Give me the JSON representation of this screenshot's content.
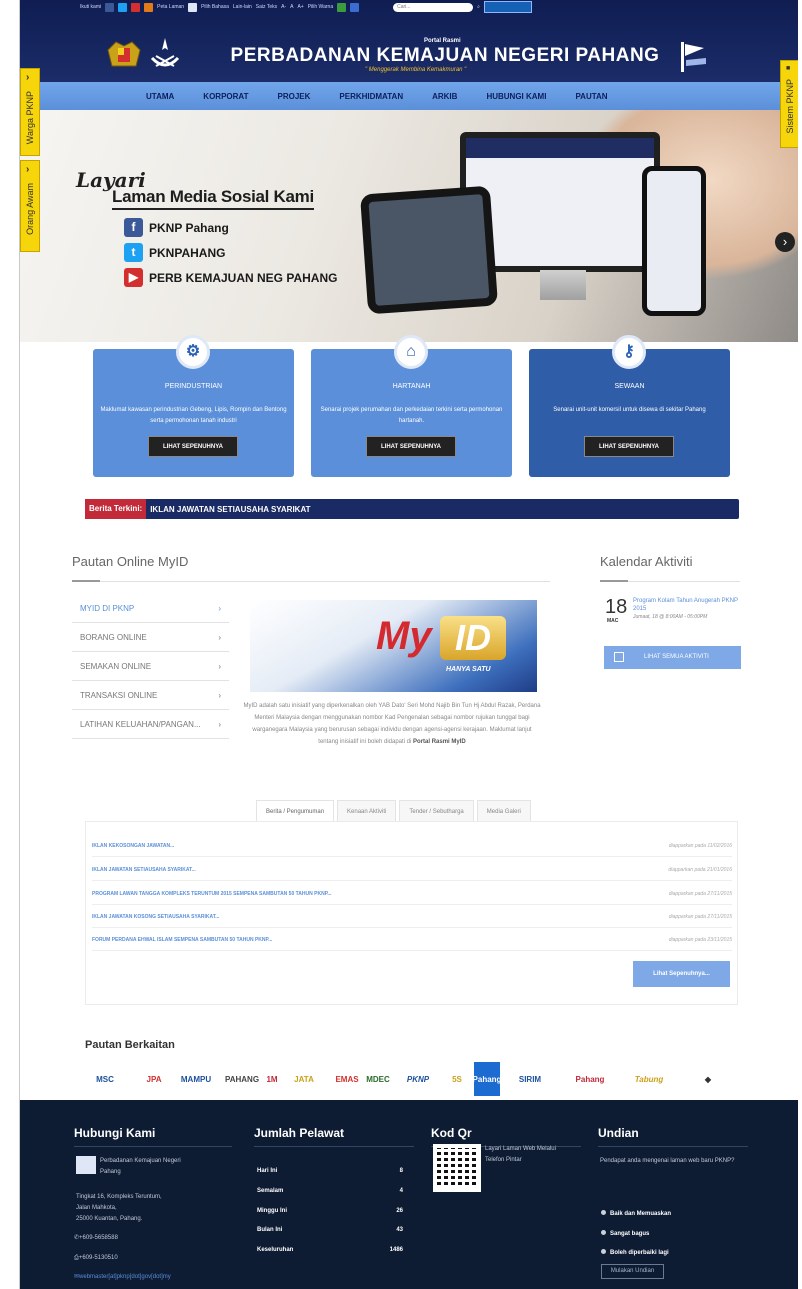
{
  "topbar": {
    "items": [
      "Ikuti kami",
      "Peta Laman",
      "Pilih Bahasa",
      "Lain-lain",
      "Saiz Teks",
      "A-",
      "A",
      "A+",
      "Pilih Warna"
    ],
    "search_placeholder": "Cari..."
  },
  "header": {
    "portal_label": "Portal Rasmi",
    "title": "PERBADANAN KEMAJUAN NEGERI PAHANG",
    "tagline": "\" Menggerak Membina Kemakmuran \""
  },
  "nav": {
    "items": [
      "UTAMA",
      "KORPORAT",
      "PROJEK",
      "PERKHIDMATAN",
      "ARKIB",
      "HUBUNGI KAMI",
      "PAUTAN"
    ]
  },
  "side_tabs": {
    "left": [
      "Warga PKNP",
      "Orang Awam"
    ],
    "right": "Sistem PKNP"
  },
  "hero": {
    "layari": "Layari",
    "heading": "Laman Media Sosial Kami",
    "socials": [
      {
        "icon": "facebook-icon",
        "glyph": "f",
        "label": "PKNP Pahang",
        "color": "#3b5998"
      },
      {
        "icon": "twitter-icon",
        "glyph": "t",
        "label": "PKNPAHANG",
        "color": "#1da1f2"
      },
      {
        "icon": "youtube-icon",
        "glyph": "▶",
        "label": "PERB KEMAJUAN NEG PAHANG",
        "color": "#d32f2f"
      }
    ]
  },
  "services": [
    {
      "icon": "factory-icon",
      "title": "PERINDUSTRIAN",
      "desc": "Maklumat kawasan perindustrian Gebeng, Lipis, Rompin dan Bentong serta permohonan tanah industri",
      "button": "LIHAT SEPENUHNYA"
    },
    {
      "icon": "house-icon",
      "title": "HARTANAH",
      "desc": "Senarai projek perumahan dan perkedaian terkini serta permohonan hartanah.",
      "button": "LIHAT SEPENUHNYA"
    },
    {
      "icon": "key-icon",
      "title": "SEWAAN",
      "desc": "Senarai unit-unit komersil untuk disewa di sekitar Pahang",
      "button": "LIHAT SEPENUHNYA"
    }
  ],
  "ticker": {
    "label": "Berita Terkini:",
    "text": "IKLAN JAWATAN SETIAUSAHA SYARIKAT"
  },
  "myid": {
    "heading": "Pautan Online MyID",
    "menu": [
      "MYID DI PKNP",
      "BORANG ONLINE",
      "SEMAKAN ONLINE",
      "TRANSAKSI ONLINE",
      "LATIHAN KELUAHAN/PANGAN..."
    ],
    "banner_my": "My",
    "banner_id": "ID",
    "banner_tag": "HANYA SATU",
    "desc": "MyID adalah satu inisiatif yang diperkenalkan oleh YAB Dato' Seri Mohd Najib Bin Tun Hj Abdul Razak, Perdana Menteri Malaysia dengan menggunakan nombor Kad Pengenalan sebagai nombor rujukan tunggal bagi warganegara Malaysia yang berurusan sebagai individu dengan agensi-agensi kerajaan. Maklumat lanjut tentang inisiatif ini boleh didapati di",
    "desc_link": "Portal Rasmi MyID"
  },
  "kalendar": {
    "heading": "Kalendar Aktiviti",
    "day": "18",
    "month": "MAC",
    "event_title": "Program Kolam Tahun Anugerah PKNP 2015",
    "event_time": "Jumaat, 18 @ 8:00AM - 05:00PM",
    "button": "LIHAT SEMUA AKTIVITI"
  },
  "news": {
    "tabs": [
      "Berita / Pengumuman",
      "Kenaan Aktiviti",
      "Tender / Sebutharga",
      "Media Galeri"
    ],
    "rows": [
      {
        "title": "IKLAN KEKOSONGAN JAWATAN...",
        "date": "diapparkan pada 11/02/2016"
      },
      {
        "title": "IKLAN JAWATAN SETIAUSAHA SYARIKAT...",
        "date": "diapparkan pada 21/01/2016"
      },
      {
        "title": "PROGRAM LAWAN TANGGA KOMPLEKS TERUNTUM 2015 SEMPENA SAMBUTAN 50 TAHUN PKNP...",
        "date": "diapparkan pada 27/11/2015"
      },
      {
        "title": "IKLAN JAWATAN KOSONG SETIAUSAHA SYARIKAT...",
        "date": "diapparkan pada 27/11/2015"
      },
      {
        "title": "FORUM PERDANA EHWAL ISLAM SEMPENA SAMBUTAN 50 TAHUN PKNP...",
        "date": "diapparkan pada 23/11/2015"
      }
    ],
    "more_button": "Lihat Sepenuhnya..."
  },
  "pautan": {
    "heading": "Pautan Berkaitan",
    "logos": [
      "MSC",
      "JPA",
      "MAMPU",
      "PAHANG",
      "1M",
      "JATA",
      "EMAS",
      "MDEC",
      "PKNP",
      "5S",
      "Pahang",
      "SIRIM",
      "Pahang",
      "Tabung"
    ]
  },
  "footer": {
    "hubungi": {
      "heading": "Hubungi Kami",
      "org": "Perbadanan Kemajuan Negeri Pahang",
      "address": [
        "Tingkat 16, Kompleks Teruntum,",
        "Jalan Mahkota,",
        "25000 Kuantan, Pahang."
      ],
      "phone": "+609-5658588",
      "fax": "+609-5130510",
      "email": "webmaster[at]pknp[dot]gov[dot]my"
    },
    "pelawat": {
      "heading": "Jumlah Pelawat",
      "rows": [
        {
          "label": "Hari Ini",
          "value": "8"
        },
        {
          "label": "Semalam",
          "value": "4"
        },
        {
          "label": "Minggu Ini",
          "value": "26"
        },
        {
          "label": "Bulan Ini",
          "value": "43"
        },
        {
          "label": "Keseluruhan",
          "value": "1486"
        }
      ]
    },
    "qr": {
      "heading": "Kod Qr",
      "text": "Layari Laman Web Melalui Telefon Pintar"
    },
    "undian": {
      "heading": "Undian",
      "question": "Pendapat anda mengenai laman web baru PKNP?",
      "options": [
        "Baik dan Memuaskan",
        "Sangat bagus",
        "Boleh diperbaiki lagi"
      ],
      "button": "Mulakan Undian"
    }
  }
}
